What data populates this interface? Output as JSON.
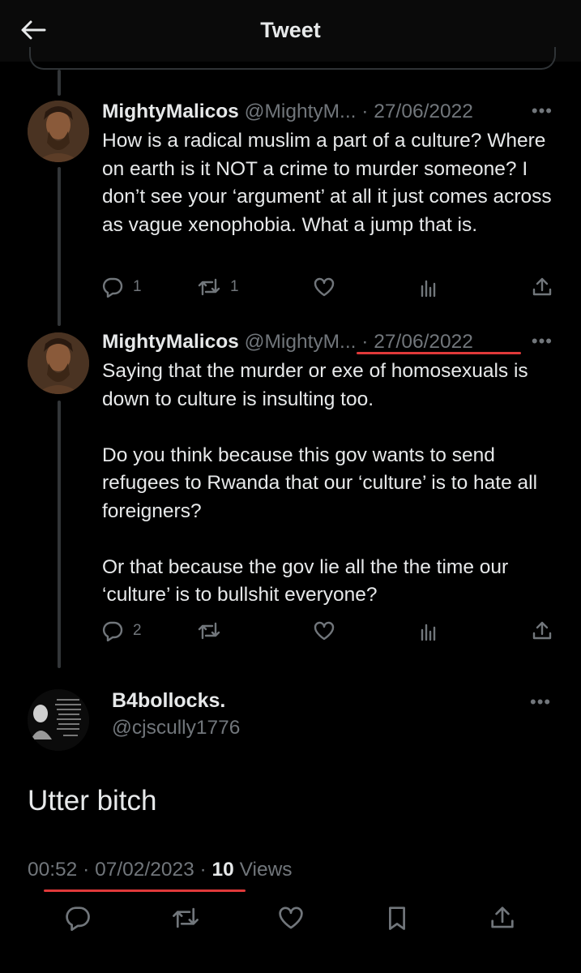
{
  "header": {
    "title": "Tweet"
  },
  "replies": [
    {
      "name": "MightyMalicos",
      "handle": "@MightyM...",
      "date": "· 27/06/2022",
      "text": "How is a radical muslim a part of a culture? Where on earth is it NOT a crime to murder someone? I don’t see your ‘argument’ at all it just comes across as vague xenophobia. What a jump that is.",
      "reply_count": "1",
      "retweet_count": "1"
    },
    {
      "name": "MightyMalicos",
      "handle": "@MightyM...",
      "date": "· 27/06/2022",
      "text": "Saying that the murder or exe of homosexuals is down to culture is insulting too.\n\nDo you think because this gov wants to send refugees to Rwanda that our ‘culture’ is to hate all foreigners?\n\nOr that because the gov lie all the the time our ‘culture’ is to bullshit everyone?",
      "reply_count": "2",
      "retweet_count": ""
    }
  ],
  "main_tweet": {
    "name": "B4bollocks.",
    "handle": "@cjscully1776",
    "text": "Utter bitch",
    "time": "00:52",
    "date": "07/02/2023",
    "views_count": "10",
    "views_label": "Views"
  },
  "colors": {
    "background": "#000000",
    "text": "#e7e9ea",
    "muted": "#71767b",
    "annotation_underline": "#e0393a"
  },
  "icons": [
    "back-arrow-icon",
    "more-icon",
    "reply-icon",
    "retweet-icon",
    "like-icon",
    "views-icon",
    "share-icon",
    "bookmark-icon"
  ]
}
